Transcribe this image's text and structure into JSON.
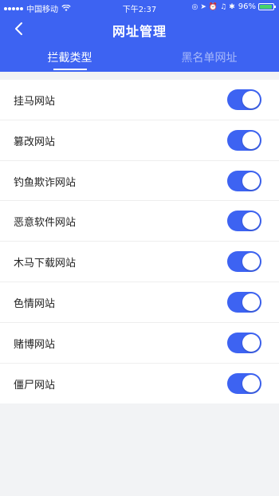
{
  "status_bar": {
    "carrier": "中国移动",
    "time": "下午2:37",
    "battery_percent": "96%",
    "battery_level": 0.96
  },
  "nav": {
    "title": "网址管理"
  },
  "tabs": [
    {
      "label": "拦截类型",
      "active": true
    },
    {
      "label": "黑名单网址",
      "active": false
    }
  ],
  "colors": {
    "primary": "#3d63f2",
    "background": "#f2f3f5"
  },
  "categories": [
    {
      "label": "挂马网站",
      "enabled": true
    },
    {
      "label": "篡改网站",
      "enabled": true
    },
    {
      "label": "钓鱼欺诈网站",
      "enabled": true
    },
    {
      "label": "恶意软件网站",
      "enabled": true
    },
    {
      "label": "木马下载网站",
      "enabled": true
    },
    {
      "label": "色情网站",
      "enabled": true
    },
    {
      "label": "赌博网站",
      "enabled": true
    },
    {
      "label": "僵尸网站",
      "enabled": true
    }
  ]
}
